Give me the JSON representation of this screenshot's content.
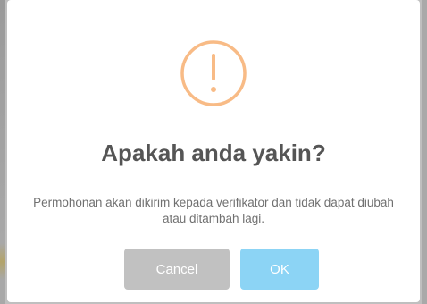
{
  "dialog": {
    "icon": "warning-exclamation-icon",
    "icon_color": "#f8bb86",
    "title": "Apakah anda yakin?",
    "message": "Permohonan akan dikirim kepada verifikator dan tidak dapat diubah atau ditambah lagi.",
    "cancel_label": "Cancel",
    "ok_label": "OK",
    "cancel_color": "#c1c1c1",
    "ok_color": "#8cd4f5"
  }
}
